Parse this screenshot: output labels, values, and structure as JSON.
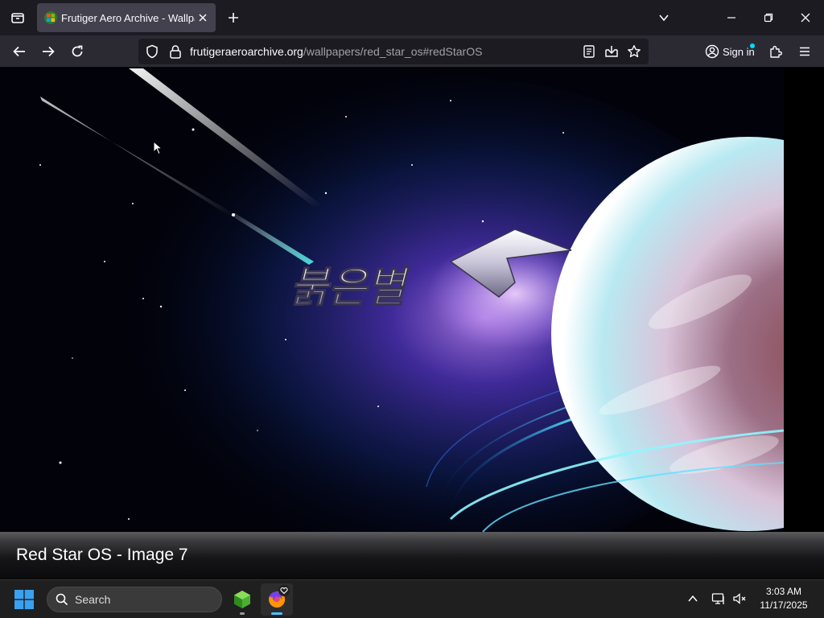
{
  "browser": {
    "tab_title": "Frutiger Aero Archive - Wallpaper",
    "url_host": "frutigeraeroarchive.org",
    "url_path": "/wallpapers/red_star_os#redStarOS",
    "sign_in": "Sign in"
  },
  "page": {
    "caption": "Red Star OS - Image 7",
    "logo_text": "붉은별"
  },
  "taskbar": {
    "search_placeholder": "Search",
    "time": "3:03 AM",
    "date": "11/17/2025"
  },
  "colors": {
    "accent": "#0078d4",
    "tab_active": "#42414d",
    "toolbar": "#2b2a33",
    "taskbar": "#1f1f1f"
  },
  "icons": [
    "tabs-list-icon",
    "close-icon",
    "plus-icon",
    "chevron-down-icon",
    "minimize-icon",
    "restore-icon",
    "back-icon",
    "forward-icon",
    "reload-icon",
    "shield-icon",
    "lock-icon",
    "reader-view-icon",
    "save-to-pocket-icon",
    "bookmark-star-icon",
    "account-icon",
    "extensions-icon",
    "menu-icon",
    "windows-start-icon",
    "search-icon",
    "cube-app-icon",
    "firefox-icon",
    "chevron-up-icon",
    "network-icon",
    "volume-muted-icon"
  ]
}
